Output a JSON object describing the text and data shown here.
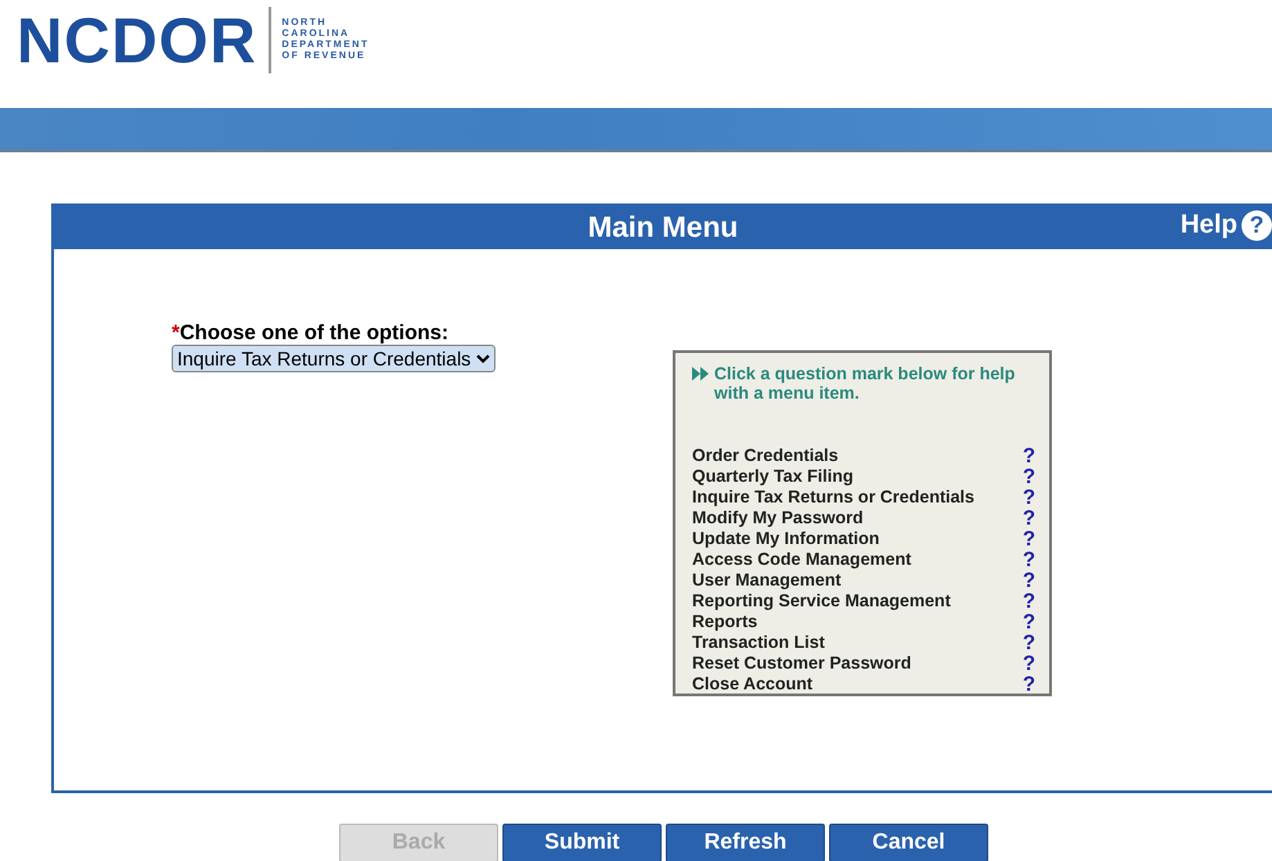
{
  "logo": {
    "wordmark": "NCDOR",
    "subtitle_lines": [
      "NORTH",
      "CAROLINA",
      "DEPARTMENT",
      "OF REVENUE"
    ]
  },
  "panel": {
    "title": "Main Menu",
    "help": "Help",
    "help_icon": "?"
  },
  "choose": {
    "required_mark": "*",
    "label": "Choose one of the options:",
    "value": "Inquire Tax Returns or Credentials"
  },
  "help_box": {
    "hint": "Click a question mark below for help with a menu item.",
    "items": [
      {
        "label": "Order Credentials",
        "help": "?"
      },
      {
        "label": "Quarterly Tax Filing",
        "help": "?"
      },
      {
        "label": "Inquire Tax Returns or Credentials",
        "help": "?"
      },
      {
        "label": "Modify My Password",
        "help": "?"
      },
      {
        "label": "Update My Information",
        "help": "?"
      },
      {
        "label": "Access Code Management",
        "help": "?"
      },
      {
        "label": "User Management",
        "help": "?"
      },
      {
        "label": "Reporting Service Management",
        "help": "?"
      },
      {
        "label": "Reports",
        "help": "?"
      },
      {
        "label": "Transaction List",
        "help": "?"
      },
      {
        "label": "Reset Customer Password",
        "help": "?"
      },
      {
        "label": "Close Account",
        "help": "?"
      }
    ]
  },
  "buttons": [
    {
      "label": "Back",
      "disabled": true
    },
    {
      "label": "Submit",
      "disabled": false
    },
    {
      "label": "Refresh",
      "disabled": false
    },
    {
      "label": "Cancel",
      "disabled": false
    }
  ]
}
